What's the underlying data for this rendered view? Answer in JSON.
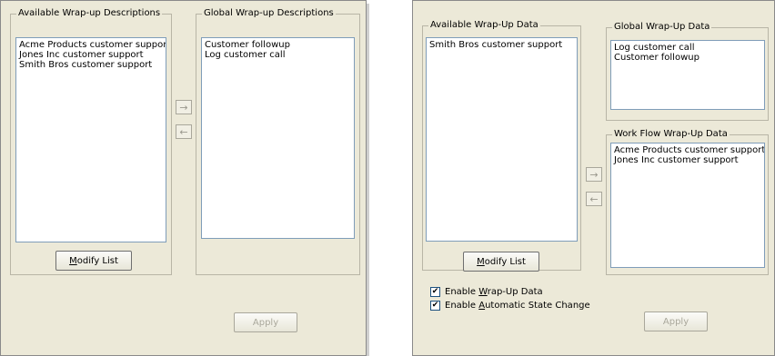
{
  "left_panel": {
    "available": {
      "legend": "Available Wrap-up Descriptions",
      "items": [
        "Acme Products customer support",
        "Jones Inc customer support",
        "Smith Bros customer support"
      ]
    },
    "global": {
      "legend": "Global Wrap-up Descriptions",
      "items": [
        "Customer followup",
        "Log customer call"
      ]
    },
    "modify_button": {
      "pre": "",
      "ul": "M",
      "post": "odify List"
    },
    "apply_button": "Apply",
    "arrow_right": "→",
    "arrow_left": "←"
  },
  "right_panel": {
    "available": {
      "legend": "Available Wrap-Up Data",
      "items": [
        "Smith Bros customer support"
      ]
    },
    "global": {
      "legend": "Global Wrap-Up Data",
      "items": [
        "Log customer call",
        "Customer followup"
      ]
    },
    "workflow": {
      "legend": "Work Flow Wrap-Up Data",
      "items": [
        "Acme Products customer support",
        "Jones Inc customer support"
      ]
    },
    "modify_button": {
      "pre": "",
      "ul": "M",
      "post": "odify List"
    },
    "apply_button": "Apply",
    "arrow_right": "→",
    "arrow_left": "←",
    "check_enable_data": {
      "pre": "Enable ",
      "ul": "W",
      "post": "rap-Up Data",
      "checked": true
    },
    "check_auto_state": {
      "pre": "Enable ",
      "ul": "A",
      "post": "utomatic State Change",
      "checked": true
    }
  }
}
